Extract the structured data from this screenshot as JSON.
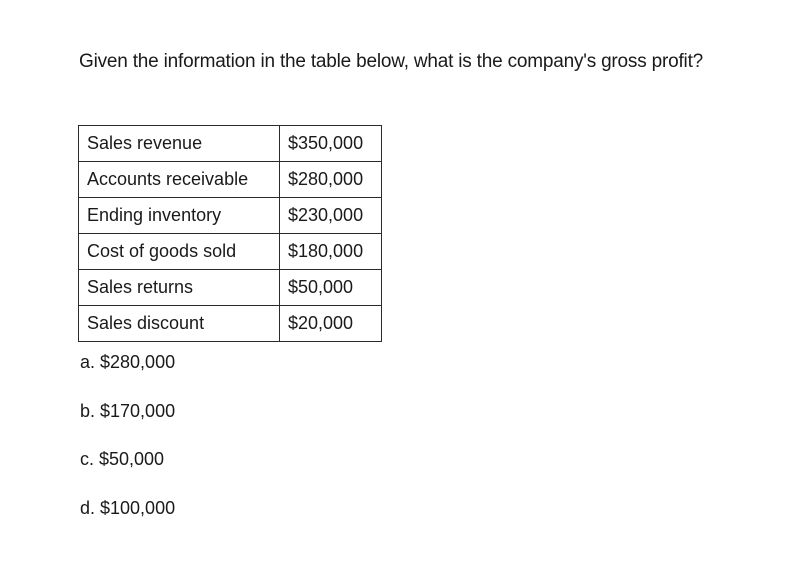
{
  "question": "Given the information in the table below, what is the company's gross profit?",
  "table": {
    "rows": [
      {
        "label": "Sales revenue",
        "value": "$350,000"
      },
      {
        "label": "Accounts receivable",
        "value": "$280,000"
      },
      {
        "label": "Ending inventory",
        "value": "$230,000"
      },
      {
        "label": "Cost of goods sold",
        "value": "$180,000"
      },
      {
        "label": "Sales returns",
        "value": "$50,000"
      },
      {
        "label": "Sales discount",
        "value": "$20,000"
      }
    ]
  },
  "options": [
    "a. $280,000",
    "b. $170,000",
    "c. $50,000",
    "d. $100,000"
  ]
}
